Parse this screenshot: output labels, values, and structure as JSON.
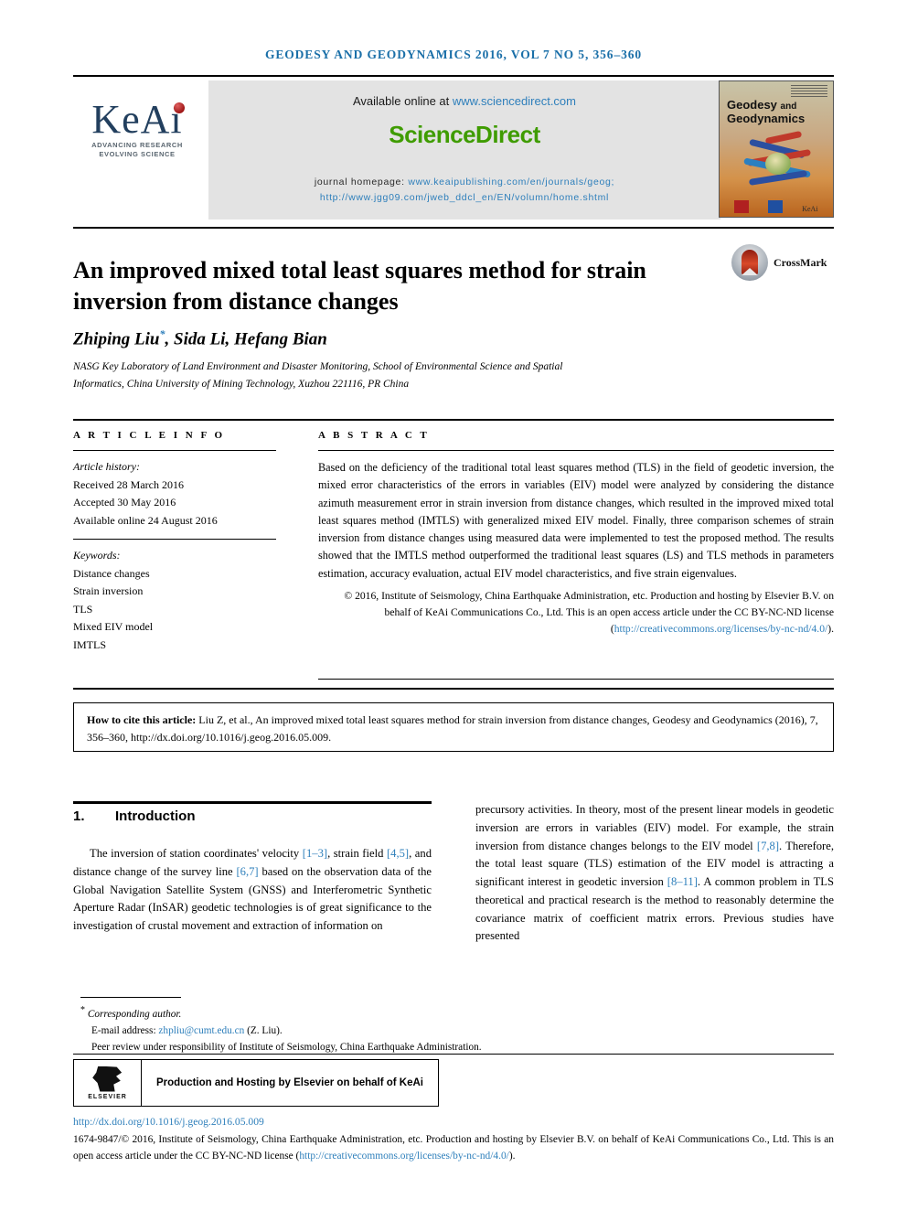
{
  "masthead": "GEODESY AND GEODYNAMICS 2016, VOL 7 NO 5, 356–360",
  "header": {
    "keai": {
      "wordmark": "KeAi",
      "tagline_1": "ADVANCING RESEARCH",
      "tagline_2": "EVOLVING SCIENCE"
    },
    "sciencedirect": {
      "available_prefix": "Available online at ",
      "available_url": "www.sciencedirect.com",
      "logo": "ScienceDirect",
      "homepage_label": "journal homepage: ",
      "homepage_url_1": "www.keaipublishing.com/en/journals/geog;",
      "homepage_url_2": "http://www.jgg09.com/jweb_ddcl_en/EN/volumn/home.shtml"
    },
    "cover": {
      "title_line_1": "Geodesy",
      "title_and": "and",
      "title_line_2": "Geodynamics",
      "keai_label": "KeAi"
    }
  },
  "article": {
    "title": "An improved mixed total least squares method for strain inversion from distance changes",
    "crossmark_label": "CrossMark",
    "authors": "Zhiping Liu",
    "authors_star": "*",
    "authors_rest": ", Sida Li, Hefang Bian",
    "affiliation": "NASG Key Laboratory of Land Environment and Disaster Monitoring, School of Environmental Science and Spatial Informatics, China University of Mining Technology, Xuzhou 221116, PR China"
  },
  "article_info": {
    "heading": "A R T I C L E   I N F O",
    "history_label": "Article history:",
    "history": [
      "Received 28 March 2016",
      "Accepted 30 May 2016",
      "Available online 24 August 2016"
    ],
    "keywords_label": "Keywords:",
    "keywords": [
      "Distance changes",
      "Strain inversion",
      "TLS",
      "Mixed EIV model",
      "IMTLS"
    ]
  },
  "abstract": {
    "heading": "A B S T R A C T",
    "body": "Based on the deficiency of the traditional total least squares method (TLS) in the field of geodetic inversion, the mixed error characteristics of the errors in variables (EIV) model were analyzed by considering the distance azimuth measurement error in strain inversion from distance changes, which resulted in the improved mixed total least squares method (IMTLS) with generalized mixed EIV model. Finally, three comparison schemes of strain inversion from distance changes using measured data were implemented to test the proposed method. The results showed that the IMTLS method outperformed the traditional least squares (LS) and TLS methods in parameters estimation, accuracy evaluation, actual EIV model characteristics, and five strain eigenvalues.",
    "copyright_text": "© 2016, Institute of Seismology, China Earthquake Administration, etc. Production and hosting by Elsevier B.V. on behalf of KeAi Communications Co., Ltd. This is an open access article under the CC BY-NC-ND license (",
    "copyright_link": "http://creativecommons.org/licenses/by-nc-nd/4.0/",
    "copyright_tail": ")."
  },
  "how_to_cite": {
    "label": "How to cite this article:",
    "text": " Liu Z, et al., An improved mixed total least squares method for strain inversion from distance changes, Geodesy and Geodynamics (2016), 7, 356–360, http://dx.doi.org/10.1016/j.geog.2016.05.009."
  },
  "introduction": {
    "number": "1.",
    "title": "Introduction",
    "left_p1_a": "The inversion of station coordinates' velocity ",
    "left_ref1": "[1–3]",
    "left_p1_b": ", strain field ",
    "left_ref2": "[4,5]",
    "left_p1_c": ", and distance change of the survey line ",
    "left_ref3": "[6,7]",
    "left_p1_d": " based on the observation data of the Global Navigation Satellite System (GNSS) and Interferometric Synthetic Aperture Radar (InSAR) geodetic technologies is of great significance to the investigation of crustal movement and extraction of information on",
    "right_p1_a": "precursory activities. In theory, most of the present linear models in geodetic inversion are errors in variables (EIV) model. For example, the strain inversion from distance changes belongs to the EIV model ",
    "right_ref1": "[7,8]",
    "right_p1_b": ". Therefore, the total least square (TLS) estimation of the EIV model is attracting a significant interest in geodetic inversion ",
    "right_ref2": "[8–11]",
    "right_p1_c": ". A common problem in TLS theoretical and practical research is the method to reasonably determine the covariance matrix of coefficient matrix errors. Previous studies have presented"
  },
  "footnotes": {
    "star": "*",
    "corresponding": "Corresponding author.",
    "email_label": "E-mail address: ",
    "email": "zhpliu@cumt.edu.cn",
    "email_tail": " (Z. Liu).",
    "peer_review": "Peer review under responsibility of Institute of Seismology, China Earthquake Administration."
  },
  "production": {
    "elsevier_name": "ELSEVIER",
    "text": "Production and Hosting by Elsevier on behalf of KeAi"
  },
  "bottom": {
    "doi": "http://dx.doi.org/10.1016/j.geog.2016.05.009",
    "copyright_a": "1674-9847/© 2016, Institute of Seismology, China Earthquake Administration, etc. Production and hosting by Elsevier B.V. on behalf of KeAi Communications Co., Ltd. This is an open access article under the CC BY-NC-ND license (",
    "copyright_link": "http://creativecommons.org/licenses/by-nc-nd/4.0/",
    "copyright_b": ")."
  },
  "colors": {
    "link": "#2e7fbb",
    "sciencedirect_green": "#3f9c00",
    "keai_navy": "#223f5e",
    "masthead_blue": "#1a6fa8"
  }
}
